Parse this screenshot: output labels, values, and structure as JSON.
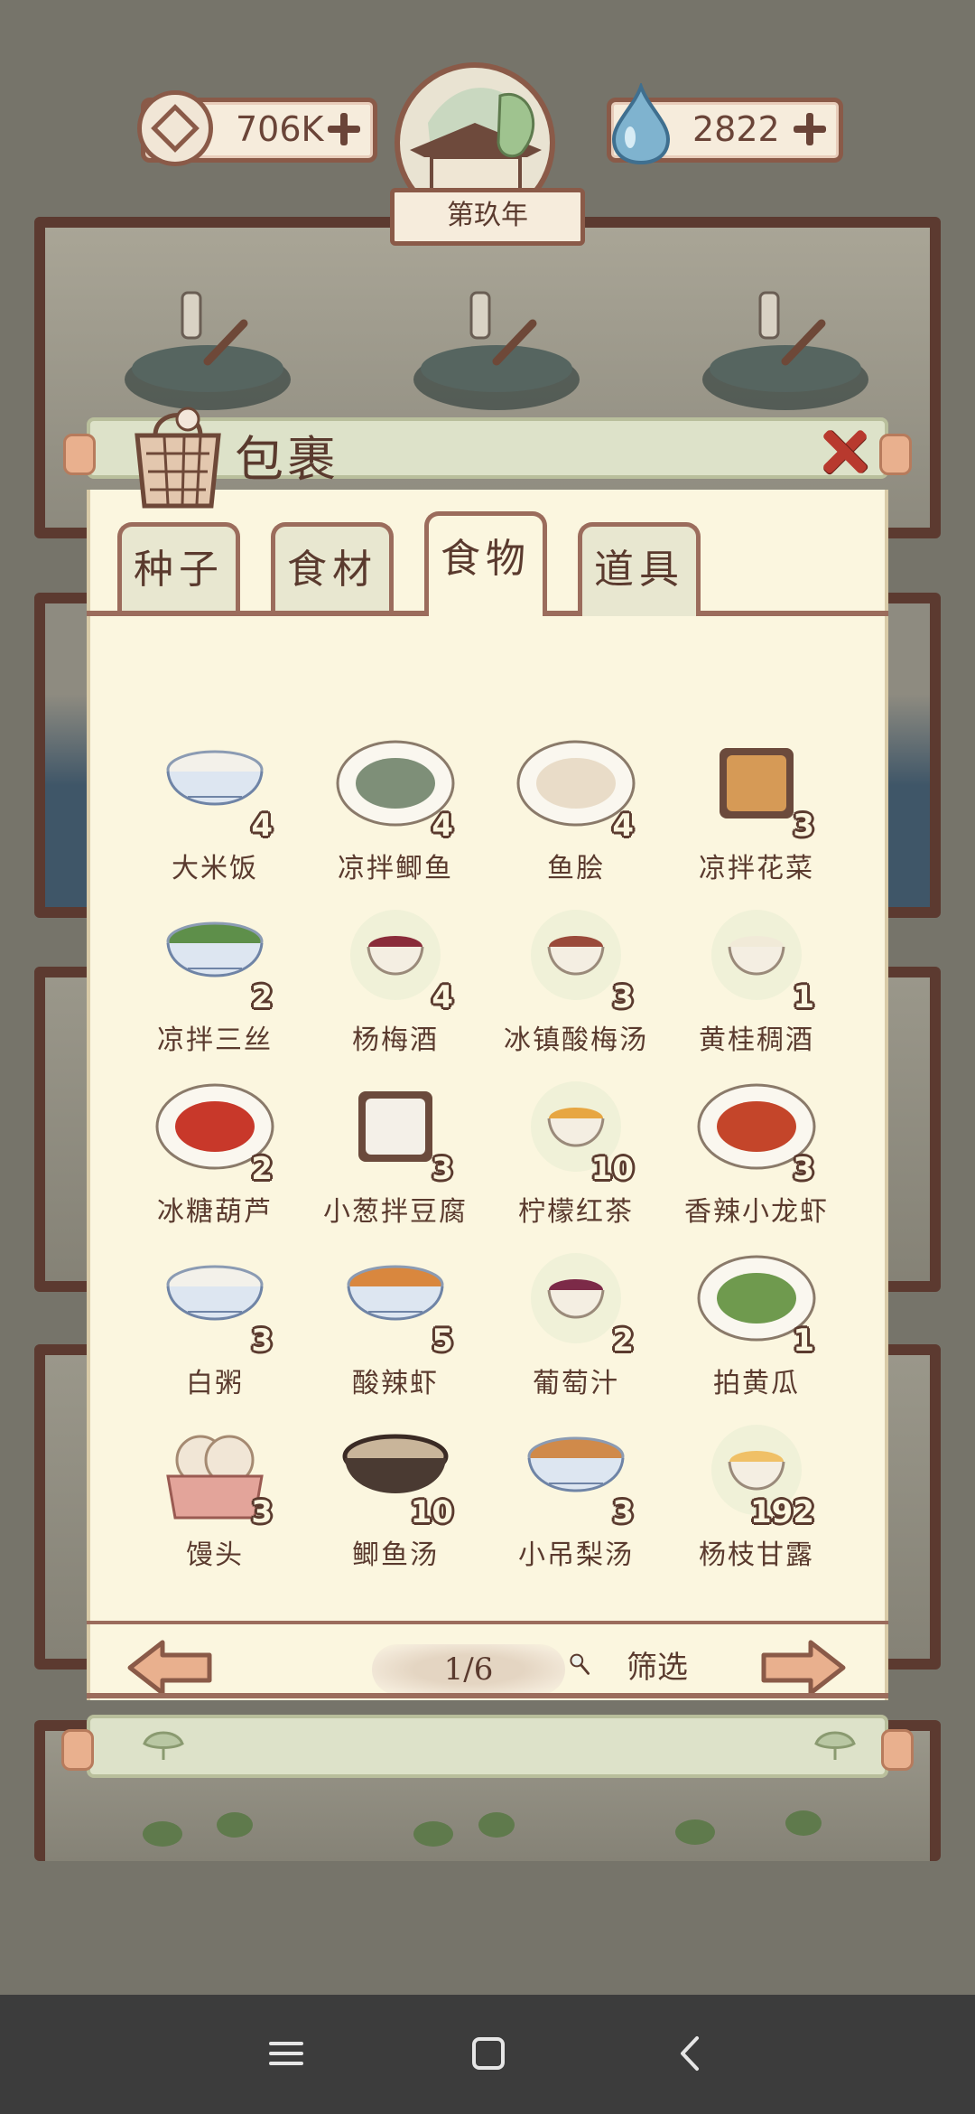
{
  "hud": {
    "coins": "706K",
    "coin_icon": "coin-icon",
    "water": "2822",
    "water_icon": "water-drop-icon",
    "year": "第玖年"
  },
  "modal": {
    "title": "包裹",
    "tabs": [
      {
        "label": "种子",
        "active": false
      },
      {
        "label": "食材",
        "active": false
      },
      {
        "label": "食物",
        "active": true
      },
      {
        "label": "道具",
        "active": false
      }
    ],
    "items": [
      {
        "name": "大米饭",
        "count": "4"
      },
      {
        "name": "凉拌鲫鱼",
        "count": "4"
      },
      {
        "name": "鱼脍",
        "count": "4"
      },
      {
        "name": "凉拌花菜",
        "count": "3"
      },
      {
        "name": "凉拌三丝",
        "count": "2"
      },
      {
        "name": "杨梅酒",
        "count": "4"
      },
      {
        "name": "冰镇酸梅汤",
        "count": "3"
      },
      {
        "name": "黄桂稠酒",
        "count": "1"
      },
      {
        "name": "冰糖葫芦",
        "count": "2"
      },
      {
        "name": "小葱拌豆腐",
        "count": "3"
      },
      {
        "name": "柠檬红茶",
        "count": "10"
      },
      {
        "name": "香辣小龙虾",
        "count": "3"
      },
      {
        "name": "白粥",
        "count": "3"
      },
      {
        "name": "酸辣虾",
        "count": "5"
      },
      {
        "name": "葡萄汁",
        "count": "2"
      },
      {
        "name": "拍黄瓜",
        "count": "1"
      },
      {
        "name": "馒头",
        "count": "3"
      },
      {
        "name": "鲫鱼汤",
        "count": "10"
      },
      {
        "name": "小吊梨汤",
        "count": "3"
      },
      {
        "name": "杨枝甘露",
        "count": "192"
      }
    ],
    "pagination": "1/6",
    "filter_label": "筛选"
  },
  "colors": {
    "frame": "#5c3a30",
    "paper": "#fbf6df",
    "accent_red": "#b8392e",
    "text": "#5a3a2e"
  }
}
